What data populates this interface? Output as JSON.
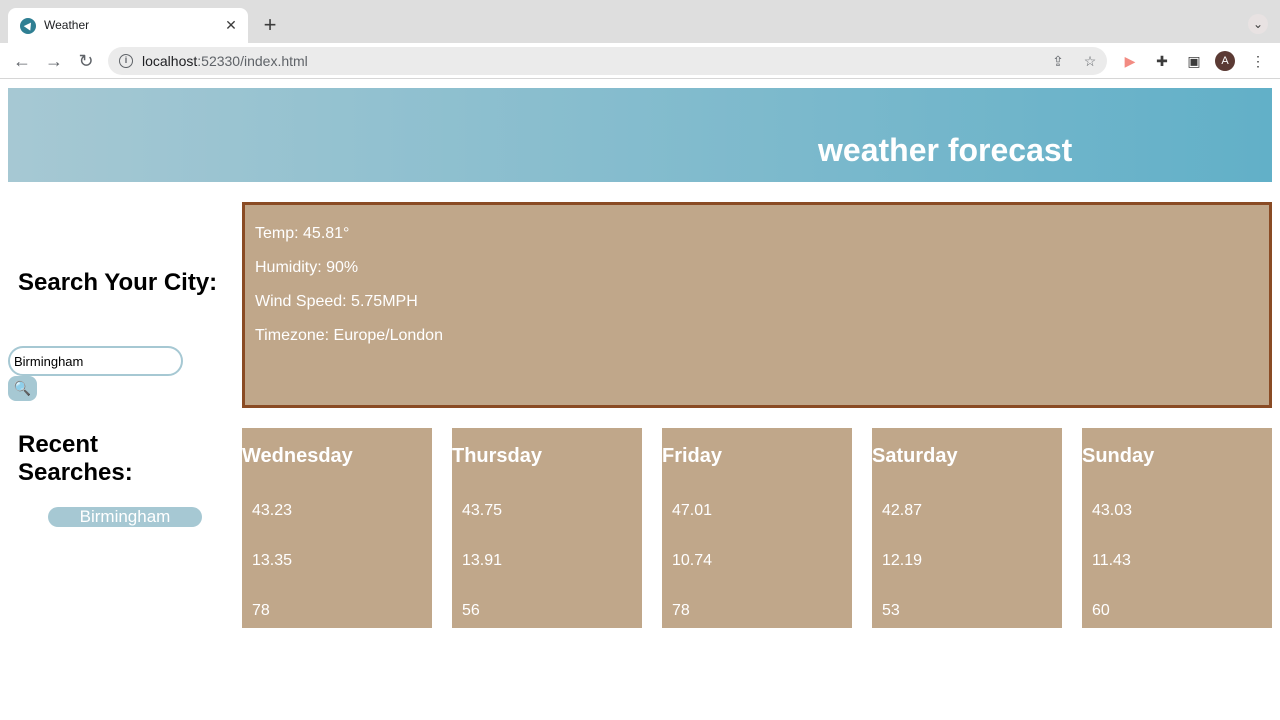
{
  "browser": {
    "tab_title": "Weather",
    "close_glyph": "✕",
    "newtab_glyph": "+",
    "tabsearch_glyph": "⌄",
    "url_host": "localhost",
    "url_rest": ":52330/index.html",
    "icons": [
      "back-icon",
      "forward-icon",
      "reload-icon",
      "info-icon",
      "share-icon",
      "star-icon",
      "extension-icon",
      "puzzle-icon",
      "sidepanel-icon",
      "menu-icon"
    ],
    "avatar_letter": "A"
  },
  "header": {
    "title": "weather forecast"
  },
  "sidebar": {
    "search_heading": "Search Your City:",
    "search_value": "Birmingham",
    "search_button_icon": "🔍",
    "recent_heading": "Recent Searches:",
    "recent_items": [
      "Birmingham"
    ]
  },
  "current": {
    "temp": "Temp: 45.81°",
    "humidity": "Humidity: 90%",
    "wind": "Wind Speed: 5.75MPH",
    "timezone": "Timezone: Europe/London"
  },
  "forecast": [
    {
      "day": "Wednesday",
      "v1": "43.23",
      "v2": "13.35",
      "v3": "78"
    },
    {
      "day": "Thursday",
      "v1": "43.75",
      "v2": "13.91",
      "v3": "56"
    },
    {
      "day": "Friday",
      "v1": "47.01",
      "v2": "10.74",
      "v3": "78"
    },
    {
      "day": "Saturday",
      "v1": "42.87",
      "v2": "12.19",
      "v3": "53"
    },
    {
      "day": "Sunday",
      "v1": "43.03",
      "v2": "11.43",
      "v3": "60"
    }
  ],
  "colors": {
    "banner_start": "#a6c8d3",
    "banner_end": "#62b0c8",
    "card_bg": "#c0a78a",
    "current_border": "#8a4b24",
    "accent": "#a6c8d3"
  }
}
